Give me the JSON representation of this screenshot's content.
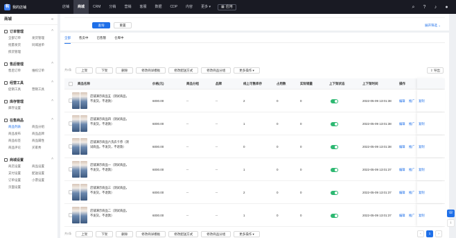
{
  "brand": {
    "logo": "有",
    "name": "我的店铺"
  },
  "topnav": [
    "店铺",
    "商城",
    "CRM",
    "分销",
    "营销",
    "客服",
    "数据",
    "CDP",
    "内容",
    "更多"
  ],
  "topnav_active": 1,
  "app_button": "应用",
  "top_icons": [
    "search-icon",
    "help-icon",
    "bell-icon",
    "avatar-icon"
  ],
  "sidebar": {
    "title": "商城",
    "groups": [
      {
        "name": "订单管理",
        "items": [
          "全部订单",
          "发货管理",
          "批量发货",
          "同城送单",
          "拣货管理"
        ]
      },
      {
        "name": "售后管理",
        "items": [
          "售后订单",
          "维权订单"
        ]
      },
      {
        "name": "经营工具",
        "items": [
          "促销工具",
          "营销工具"
        ]
      },
      {
        "name": "库存管理",
        "items": [
          "库存设置"
        ]
      },
      {
        "name": "在售商品",
        "items": [
          "商品列表",
          "商品分组",
          "商品发布",
          "商品品牌",
          "商品标签",
          "商品属性",
          "商品评论",
          "买家秀"
        ]
      },
      {
        "name": "商城设置",
        "items": [
          "商店设置",
          "商品设置",
          "支付设置",
          "配送设置",
          "订单设置",
          "小票设置",
          "页面设置"
        ]
      }
    ],
    "active_item": "商品列表"
  },
  "filter": {
    "search_label": "查询",
    "reset_label": "重置",
    "expand_label": "展开筛选"
  },
  "tabs": [
    "全部",
    "售卖中",
    "已售罄",
    "仓库中"
  ],
  "active_tab": 0,
  "toolbar": {
    "label": "共0条",
    "buttons": [
      "上架",
      "下架",
      "删除",
      "修改商详模板",
      "修改配送方式",
      "修改商品分组",
      "更多操作"
    ]
  },
  "export_label": "导出",
  "table": {
    "headers": [
      "商品名称",
      "价格(元)",
      "商品分组",
      "品牌",
      "线上可售库存",
      "占用数",
      "实际销量",
      "上下架状态",
      "上下架时间",
      "操作"
    ],
    "rows": [
      {
        "name": "店铺演示商品五（测试商品，不发货，不退款）",
        "price": "6000.00",
        "group": "--",
        "brand": "--",
        "stock": "2",
        "occupied": "0",
        "sales": "0",
        "status_on": true,
        "time": "2022-05-09 13:01:38"
      },
      {
        "name": "店铺演示商品四（测试商品，不发货，不退款）",
        "price": "6000.00",
        "group": "--",
        "brand": "--",
        "stock": "1",
        "occupied": "0",
        "sales": "0",
        "status_on": true,
        "time": "2022-05-09 13:01:38"
      },
      {
        "name": "店铺演示商品六洗衣卡券（测试商品，不发货，不退款）",
        "price": "6000.00",
        "group": "--",
        "brand": "--",
        "stock": "0",
        "occupied": "0",
        "sales": "0",
        "status_on": true,
        "time": "2022-05-09 13:01:38"
      },
      {
        "name": "店铺演示商品一（测试商品，不发货，不退款）",
        "price": "6000.00",
        "group": "--",
        "brand": "--",
        "stock": "1",
        "occupied": "0",
        "sales": "0",
        "status_on": true,
        "time": "2022-05-09 13:01:37"
      },
      {
        "name": "店铺演示商品三（测试商品，不发货，不退款）",
        "price": "6000.00",
        "group": "--",
        "brand": "--",
        "stock": "2",
        "occupied": "0",
        "sales": "0",
        "status_on": true,
        "time": "2022-05-09 13:01:37"
      },
      {
        "name": "店铺演示商品二（测试商品，不发货，不退款）",
        "price": "6000.00",
        "group": "--",
        "brand": "--",
        "stock": "1",
        "occupied": "0",
        "sales": "0",
        "status_on": true,
        "time": "2022-05-09 13:01:37"
      }
    ],
    "ops": [
      "编辑",
      "推广",
      "复制"
    ]
  },
  "pager": {
    "prev": "‹",
    "current": "1",
    "next": "›"
  },
  "colors": {
    "accent": "#1e6fe8",
    "topbar": "#191a23",
    "toggle_on": "#2eb872"
  }
}
